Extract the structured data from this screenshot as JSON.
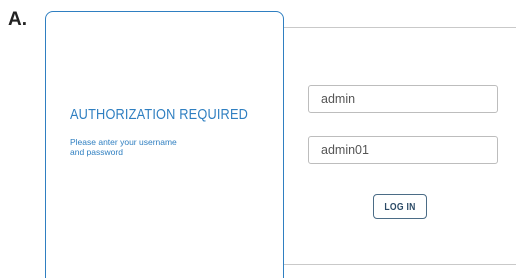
{
  "figure": {
    "label": "A."
  },
  "auth_card": {
    "title": "AUTHORIZATION REQUIRED",
    "subtitle_line1": "Please anter your username",
    "subtitle_line2": "and password"
  },
  "login_form": {
    "username_value": "admin",
    "password_value": "admin01",
    "login_button_label": "LOG IN"
  },
  "colors": {
    "accent": "#2f7fc1",
    "button_border": "#4b6c86",
    "divider": "#c9c9c9",
    "field_border": "#bdbdbd"
  }
}
